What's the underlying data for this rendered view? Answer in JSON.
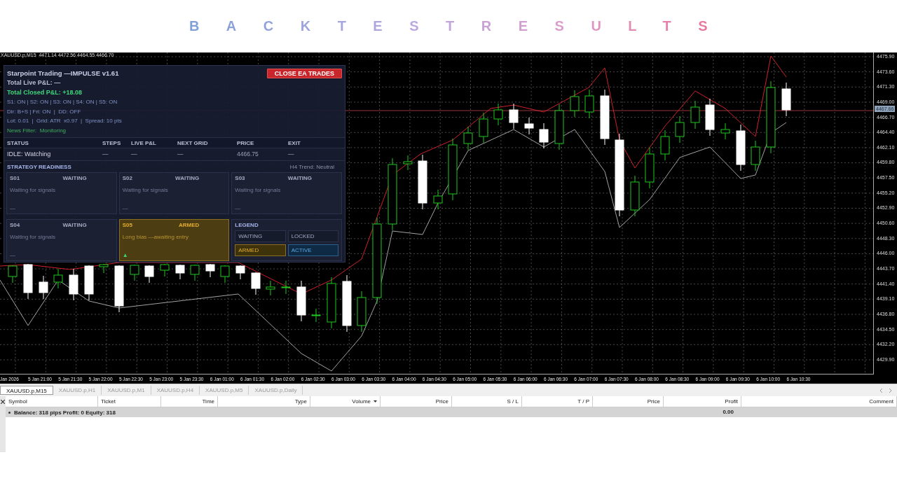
{
  "banner": {
    "title": "BACKTESTRESULTS"
  },
  "chart": {
    "caption": "XAUUSD.p,M15  4471.14 4472.56 4464.55 4466.70",
    "price_ticks": [
      "4475.90",
      "4473.60",
      "4471.30",
      "4469.00",
      "4466.70",
      "4464.40",
      "4462.10",
      "4459.80",
      "4457.50",
      "4455.20",
      "4452.90",
      "4450.60",
      "4448.30",
      "4446.00",
      "4443.70",
      "4441.40",
      "4439.10",
      "4436.80",
      "4434.50",
      "4432.20",
      "4429.90"
    ],
    "current_price": "4467.66",
    "time_ticks": [
      "Jan 2026",
      "5 Jan 21:00",
      "5 Jan 21:30",
      "5 Jan 22:00",
      "5 Jan 22:30",
      "5 Jan 23:00",
      "5 Jan 23:30",
      "6 Jan 01:00",
      "6 Jan 01:30",
      "6 Jan 02:00",
      "6 Jan 02:30",
      "6 Jan 03:00",
      "6 Jan 03:30",
      "6 Jan 04:00",
      "6 Jan 04:30",
      "6 Jan 05:00",
      "6 Jan 05:30",
      "6 Jan 06:00",
      "6 Jan 06:30",
      "6 Jan 07:00",
      "6 Jan 07:30",
      "6 Jan 08:00",
      "6 Jan 08:30",
      "6 Jan 09:00",
      "6 Jan 09:30",
      "6 Jan 10:00",
      "6 Jan 10:30"
    ]
  },
  "ea_panel": {
    "title": "Starpoint Trading —IMPULSE v1.61",
    "close_button": "CLOSE EA TRADES",
    "totals": [
      {
        "text": "Total Live P&L:  —",
        "kind": "neutral"
      },
      {
        "text": "Total Closed P&L:  +18.08",
        "kind": "positive"
      }
    ],
    "info_lines": [
      {
        "text": "S1: ON | S2: ON | S3: ON | S4: ON | S5: ON",
        "kind": "info"
      },
      {
        "text": "Dir: B+S | Fri: ON  |  DD: OFF",
        "kind": "info"
      },
      {
        "text": "Lot: 0.01  |  Grid: ATR  x0.97  |  Spread: 10 pts",
        "kind": "info"
      },
      {
        "text": "News Filter:  Monitoring",
        "kind": "news"
      }
    ],
    "status_table": {
      "columns": [
        "STATUS",
        "STEPS",
        "LIVE P&L",
        "NEXT GRID",
        "PRICE",
        "EXIT"
      ],
      "row": [
        "IDLE: Watching",
        "—",
        "—",
        "—",
        "4466.75",
        "—"
      ]
    },
    "readiness": {
      "title": "STRATEGY READINESS",
      "trend": "H4 Trend: Neutral",
      "cards": [
        {
          "id": "S01",
          "status": "WAITING",
          "kind": "waiting",
          "note": "Waiting for signals",
          "footer": "—"
        },
        {
          "id": "S02",
          "status": "WAITING",
          "kind": "waiting",
          "note": "Waiting for signals",
          "footer": "—"
        },
        {
          "id": "S03",
          "status": "WAITING",
          "kind": "waiting",
          "note": "Waiting for signals",
          "footer": "—"
        },
        {
          "id": "S04",
          "status": "WAITING",
          "kind": "waiting",
          "note": "Waiting for signals",
          "footer": "—"
        },
        {
          "id": "S05",
          "status": "ARMED",
          "kind": "armed",
          "note": "Long bias —awaiting entry",
          "footer": "▲"
        }
      ],
      "legend": {
        "title": "LEGEND",
        "items": [
          {
            "label": "WAITING",
            "kind": "waiting"
          },
          {
            "label": "LOCKED",
            "kind": "locked"
          },
          {
            "label": "ARMED",
            "kind": "armed"
          },
          {
            "label": "ACTIVE",
            "kind": "active"
          }
        ]
      }
    }
  },
  "tabs": [
    {
      "label": "XAUUSD.p,M15",
      "selected": true
    },
    {
      "label": "XAUUSD.p,H1",
      "selected": false
    },
    {
      "label": "XAUUSD.p,M1",
      "selected": false
    },
    {
      "label": "XAUUSD.p,H4",
      "selected": false
    },
    {
      "label": "XAUUSD.p,M5",
      "selected": false
    },
    {
      "label": "XAUUSD.p,Daily",
      "selected": false
    }
  ],
  "trade_table": {
    "columns": [
      {
        "label": "Symbol",
        "sorted": false
      },
      {
        "label": "Ticket",
        "sorted": false
      },
      {
        "label": "Time",
        "sorted": false
      },
      {
        "label": "Type",
        "sorted": false
      },
      {
        "label": "Volume",
        "sorted": true
      },
      {
        "label": "Price",
        "sorted": false
      },
      {
        "label": "S / L",
        "sorted": false
      },
      {
        "label": "T / P",
        "sorted": false
      },
      {
        "label": "Price",
        "sorted": false
      },
      {
        "label": "Profit",
        "sorted": false
      },
      {
        "label": "Comment",
        "sorted": false
      }
    ],
    "balance_row": {
      "summary": "Balance: 318 pips   Profit: 0   Equity: 318",
      "profit": "0.00"
    }
  }
}
